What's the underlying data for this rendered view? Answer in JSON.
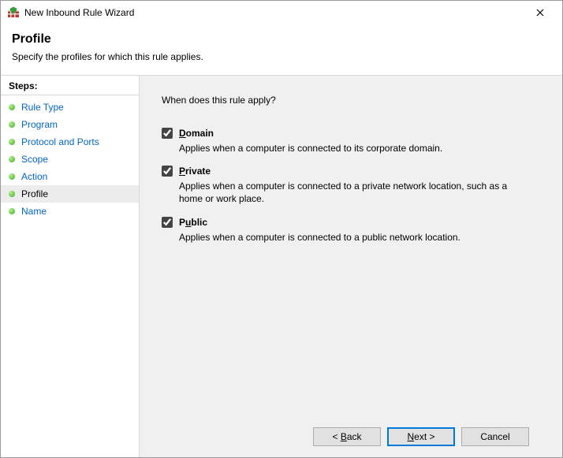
{
  "window": {
    "title": "New Inbound Rule Wizard"
  },
  "header": {
    "title": "Profile",
    "subtitle": "Specify the profiles for which this rule applies."
  },
  "sidebar": {
    "heading": "Steps:",
    "items": [
      {
        "label": "Rule Type",
        "current": false
      },
      {
        "label": "Program",
        "current": false
      },
      {
        "label": "Protocol and Ports",
        "current": false
      },
      {
        "label": "Scope",
        "current": false
      },
      {
        "label": "Action",
        "current": false
      },
      {
        "label": "Profile",
        "current": true
      },
      {
        "label": "Name",
        "current": false
      }
    ]
  },
  "content": {
    "prompt": "When does this rule apply?",
    "options": [
      {
        "key": "domain",
        "label_pre": "",
        "label_mn": "D",
        "label_post": "omain",
        "checked": true,
        "description": "Applies when a computer is connected to its corporate domain."
      },
      {
        "key": "private",
        "label_pre": "",
        "label_mn": "P",
        "label_post": "rivate",
        "checked": true,
        "description": "Applies when a computer is connected to a private network location, such as a home or work place."
      },
      {
        "key": "public",
        "label_pre": "P",
        "label_mn": "u",
        "label_post": "blic",
        "checked": true,
        "description": "Applies when a computer is connected to a public network location."
      }
    ]
  },
  "footer": {
    "back": {
      "pre": "< ",
      "mn": "B",
      "post": "ack"
    },
    "next": {
      "pre": "",
      "mn": "N",
      "post": "ext >"
    },
    "cancel": "Cancel"
  }
}
